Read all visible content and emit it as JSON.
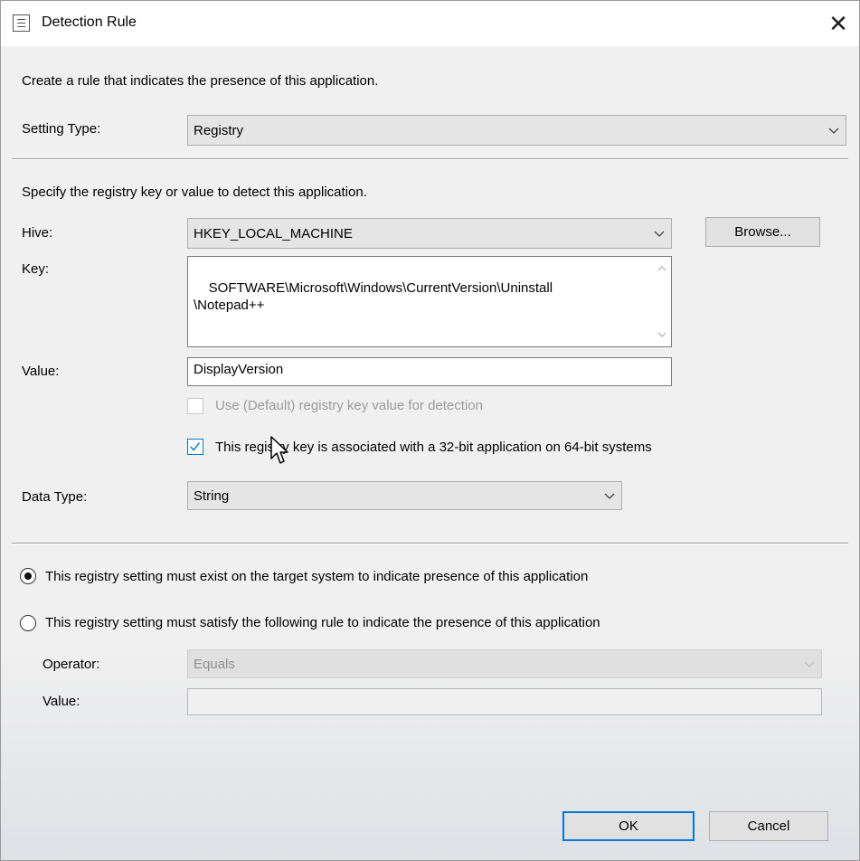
{
  "window": {
    "title": "Detection Rule",
    "close_glyph": "✕"
  },
  "intro": "Create a rule that indicates the presence of this application.",
  "setting_type": {
    "label": "Setting Type:",
    "value": "Registry"
  },
  "registry_intro": "Specify the registry key or value to detect this application.",
  "hive": {
    "label": "Hive:",
    "value": "HKEY_LOCAL_MACHINE",
    "browse_label": "Browse..."
  },
  "key": {
    "label": "Key:",
    "value": "SOFTWARE\\Microsoft\\Windows\\CurrentVersion\\Uninstall\n\\Notepad++"
  },
  "value": {
    "label": "Value:",
    "value": "DisplayVersion"
  },
  "use_default": {
    "label": "Use (Default) registry key value for detection",
    "checked": false,
    "enabled": false
  },
  "is32bit": {
    "label": "This registry key is associated with a 32-bit application on 64-bit systems",
    "checked": true
  },
  "data_type": {
    "label": "Data Type:",
    "value": "String"
  },
  "radio_exist": {
    "label": "This registry setting must exist on the target system to indicate presence of this application",
    "selected": true
  },
  "radio_rule": {
    "label": "This registry setting must satisfy the following rule to indicate the presence of this application",
    "selected": false
  },
  "operator": {
    "label": "Operator:",
    "value": "Equals",
    "enabled": false
  },
  "rule_value": {
    "label": "Value:",
    "value": "",
    "enabled": false
  },
  "buttons": {
    "ok": "OK",
    "cancel": "Cancel"
  },
  "colors": {
    "accent": "#0078d7",
    "dialog_bg": "#f0f0f0",
    "disabled_text": "#9b9b9b"
  }
}
